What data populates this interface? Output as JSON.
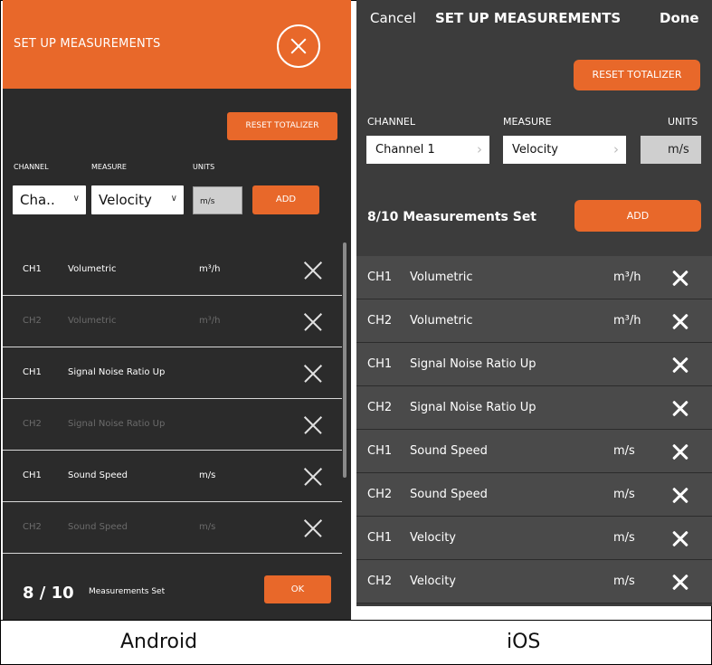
{
  "android": {
    "title": "SET UP MEASUREMENTS",
    "close_icon": "close-circle-icon",
    "reset_label": "RESET TOTALIZER",
    "labels": {
      "channel": "CHANNEL",
      "measure": "MEASURE",
      "units": "UNITS"
    },
    "channel_value": "Cha..",
    "measure_value": "Velocity",
    "units_value": "m/s",
    "add_label": "ADD",
    "rows": [
      {
        "channel": "CH1",
        "measure": "Volumetric",
        "units": "m³/h",
        "dim": false
      },
      {
        "channel": "CH2",
        "measure": "Volumetric",
        "units": "m³/h",
        "dim": true
      },
      {
        "channel": "CH1",
        "measure": "Signal Noise Ratio Up",
        "units": "",
        "dim": false
      },
      {
        "channel": "CH2",
        "measure": "Signal Noise Ratio Up",
        "units": "",
        "dim": true
      },
      {
        "channel": "CH1",
        "measure": "Sound Speed",
        "units": "m/s",
        "dim": false
      },
      {
        "channel": "CH2",
        "measure": "Sound Speed",
        "units": "m/s",
        "dim": true
      }
    ],
    "count": "8 / 10",
    "count_label": "Measurements Set",
    "ok_label": "OK",
    "caption": "Android"
  },
  "ios": {
    "cancel_label": "Cancel",
    "title": "SET UP MEASUREMENTS",
    "done_label": "Done",
    "reset_label": "RESET TOTALIZER",
    "labels": {
      "channel": "CHANNEL",
      "measure": "MEASURE",
      "units": "UNITS"
    },
    "channel_value": "Channel 1",
    "measure_value": "Velocity",
    "units_value": "m/s",
    "count": "8/10  Measurements Set",
    "add_label": "ADD",
    "rows": [
      {
        "channel": "CH1",
        "measure": "Volumetric",
        "units": "m³/h"
      },
      {
        "channel": "CH2",
        "measure": "Volumetric",
        "units": "m³/h"
      },
      {
        "channel": "CH1",
        "measure": "Signal Noise Ratio Up",
        "units": ""
      },
      {
        "channel": "CH2",
        "measure": "Signal Noise Ratio Up",
        "units": ""
      },
      {
        "channel": "CH1",
        "measure": "Sound Speed",
        "units": "m/s"
      },
      {
        "channel": "CH2",
        "measure": "Sound Speed",
        "units": "m/s"
      },
      {
        "channel": "CH1",
        "measure": "Velocity",
        "units": "m/s"
      },
      {
        "channel": "CH2",
        "measure": "Velocity",
        "units": "m/s"
      }
    ],
    "caption": "iOS"
  },
  "colors": {
    "accent": "#e8682a",
    "android_bg": "#2b2b2b",
    "ios_bg": "#3c3c3c"
  }
}
